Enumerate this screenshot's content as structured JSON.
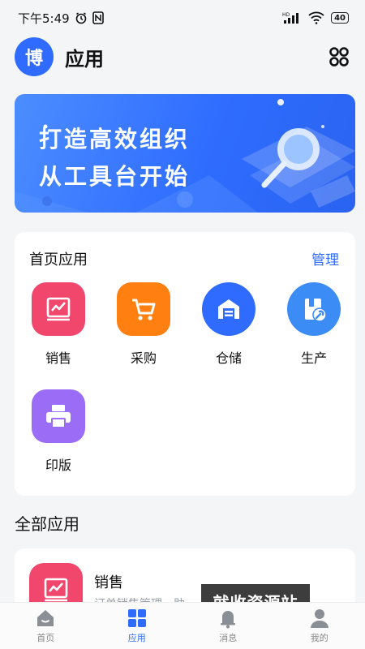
{
  "status_bar": {
    "time": "下午5:49",
    "hd_label": "HD",
    "battery": "40"
  },
  "header": {
    "avatar_text": "博",
    "title": "应用"
  },
  "banner": {
    "line1": "打造高效组织",
    "line2": "从工具台开始"
  },
  "home_apps": {
    "title": "首页应用",
    "manage_label": "管理",
    "items": [
      {
        "label": "销售",
        "color": "#f1476d"
      },
      {
        "label": "采购",
        "color": "#ff7f11"
      },
      {
        "label": "仓储",
        "color": "#2f6bff"
      },
      {
        "label": "生产",
        "color": "#3b8cf5"
      },
      {
        "label": "印版",
        "color": "#9b6cf6"
      }
    ]
  },
  "all_apps": {
    "title": "全部应用",
    "items": [
      {
        "label": "销售",
        "desc": "订单销售管理、助"
      }
    ]
  },
  "watermark": "就收资源站",
  "bottom_nav": {
    "items": [
      {
        "label": "首页"
      },
      {
        "label": "应用"
      },
      {
        "label": "消息"
      },
      {
        "label": "我的"
      }
    ],
    "active_color": "#2f6bff"
  }
}
